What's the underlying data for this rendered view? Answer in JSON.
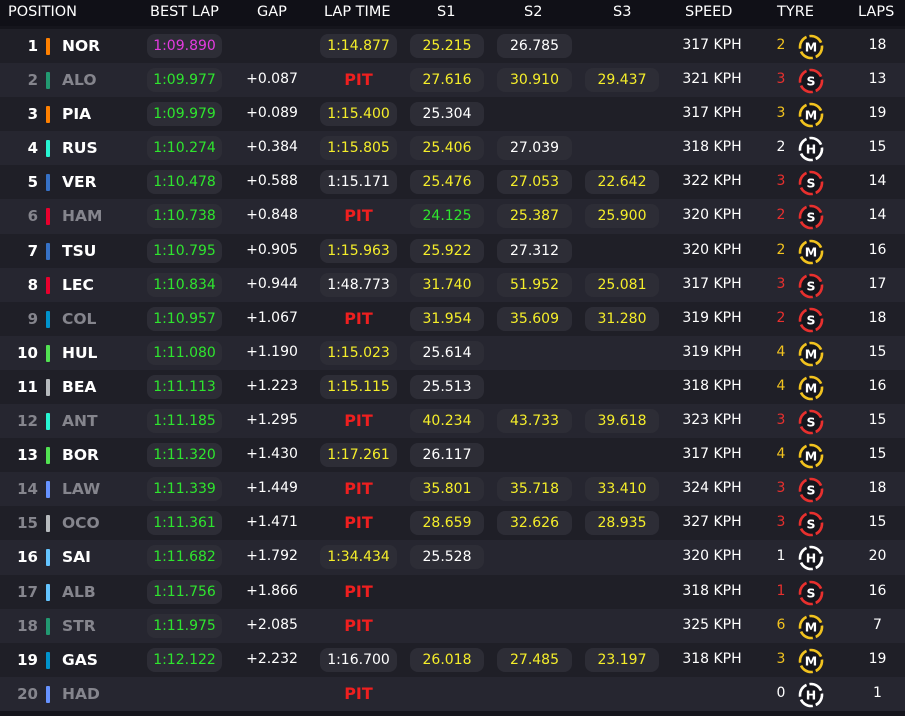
{
  "colors": {
    "purple": "#e43be0",
    "green": "#2ee52e",
    "yellow": "#f5ee2a",
    "white": "#ffffff",
    "pit_red": "#ee1f1f",
    "tyre_soft": "#e8302e",
    "tyre_medium": "#f2c31f",
    "tyre_hard": "#ffffff",
    "age_new": "#ffffff",
    "age_mid": "#f2c31f",
    "age_old": "#e8302e"
  },
  "headers": {
    "position": "POSITION",
    "best_lap": "BEST LAP",
    "gap": "GAP",
    "lap_time": "LAP TIME",
    "s1": "S1",
    "s2": "S2",
    "s3": "S3",
    "speed": "SPEED",
    "tyre": "TYRE",
    "laps": "LAPS"
  },
  "rows": [
    {
      "pos": "1",
      "code": "NOR",
      "team": "#ff8000",
      "out": false,
      "best": "1:09.890",
      "best_c": "purple",
      "gap": "",
      "lap": "1:14.877",
      "lap_c": "yellow",
      "pit": false,
      "s1": "25.215",
      "s1_c": "yellow",
      "s2": "26.785",
      "s2_c": "white",
      "s3": "",
      "s3_c": "white",
      "speed": "317 KPH",
      "tyre_age": "2",
      "age_c": "age_mid",
      "tyre": "M",
      "laps": "18"
    },
    {
      "pos": "2",
      "code": "ALO",
      "team": "#229971",
      "out": true,
      "best": "1:09.977",
      "best_c": "green",
      "gap": "+0.087",
      "lap": "PIT",
      "lap_c": "white",
      "pit": true,
      "s1": "27.616",
      "s1_c": "yellow",
      "s2": "30.910",
      "s2_c": "yellow",
      "s3": "29.437",
      "s3_c": "yellow",
      "speed": "321 KPH",
      "tyre_age": "3",
      "age_c": "age_old",
      "tyre": "S",
      "laps": "13"
    },
    {
      "pos": "3",
      "code": "PIA",
      "team": "#ff8000",
      "out": false,
      "best": "1:09.979",
      "best_c": "green",
      "gap": "+0.089",
      "lap": "1:15.400",
      "lap_c": "yellow",
      "pit": false,
      "s1": "25.304",
      "s1_c": "white",
      "s2": "",
      "s2_c": "white",
      "s3": "",
      "s3_c": "white",
      "speed": "317 KPH",
      "tyre_age": "3",
      "age_c": "age_mid",
      "tyre": "M",
      "laps": "19"
    },
    {
      "pos": "4",
      "code": "RUS",
      "team": "#27f4d2",
      "out": false,
      "best": "1:10.274",
      "best_c": "green",
      "gap": "+0.384",
      "lap": "1:15.805",
      "lap_c": "yellow",
      "pit": false,
      "s1": "25.406",
      "s1_c": "yellow",
      "s2": "27.039",
      "s2_c": "white",
      "s3": "",
      "s3_c": "white",
      "speed": "318 KPH",
      "tyre_age": "2",
      "age_c": "age_new",
      "tyre": "H",
      "laps": "15"
    },
    {
      "pos": "5",
      "code": "VER",
      "team": "#3671c6",
      "out": false,
      "best": "1:10.478",
      "best_c": "green",
      "gap": "+0.588",
      "lap": "1:15.171",
      "lap_c": "white",
      "pit": false,
      "s1": "25.476",
      "s1_c": "yellow",
      "s2": "27.053",
      "s2_c": "yellow",
      "s3": "22.642",
      "s3_c": "yellow",
      "speed": "322 KPH",
      "tyre_age": "3",
      "age_c": "age_old",
      "tyre": "S",
      "laps": "14"
    },
    {
      "pos": "6",
      "code": "HAM",
      "team": "#e8002d",
      "out": true,
      "best": "1:10.738",
      "best_c": "green",
      "gap": "+0.848",
      "lap": "PIT",
      "lap_c": "white",
      "pit": true,
      "s1": "24.125",
      "s1_c": "green",
      "s2": "25.387",
      "s2_c": "yellow",
      "s3": "25.900",
      "s3_c": "yellow",
      "speed": "320 KPH",
      "tyre_age": "2",
      "age_c": "age_old",
      "tyre": "S",
      "laps": "14"
    },
    {
      "pos": "7",
      "code": "TSU",
      "team": "#3671c6",
      "out": false,
      "best": "1:10.795",
      "best_c": "green",
      "gap": "+0.905",
      "lap": "1:15.963",
      "lap_c": "yellow",
      "pit": false,
      "s1": "25.922",
      "s1_c": "yellow",
      "s2": "27.312",
      "s2_c": "white",
      "s3": "",
      "s3_c": "white",
      "speed": "320 KPH",
      "tyre_age": "2",
      "age_c": "age_mid",
      "tyre": "M",
      "laps": "16"
    },
    {
      "pos": "8",
      "code": "LEC",
      "team": "#e8002d",
      "out": false,
      "best": "1:10.834",
      "best_c": "green",
      "gap": "+0.944",
      "lap": "1:48.773",
      "lap_c": "white",
      "pit": false,
      "s1": "31.740",
      "s1_c": "yellow",
      "s2": "51.952",
      "s2_c": "yellow",
      "s3": "25.081",
      "s3_c": "yellow",
      "speed": "317 KPH",
      "tyre_age": "3",
      "age_c": "age_old",
      "tyre": "S",
      "laps": "17"
    },
    {
      "pos": "9",
      "code": "COL",
      "team": "#0093cc",
      "out": true,
      "best": "1:10.957",
      "best_c": "green",
      "gap": "+1.067",
      "lap": "PIT",
      "lap_c": "white",
      "pit": true,
      "s1": "31.954",
      "s1_c": "yellow",
      "s2": "35.609",
      "s2_c": "yellow",
      "s3": "31.280",
      "s3_c": "yellow",
      "speed": "319 KPH",
      "tyre_age": "2",
      "age_c": "age_old",
      "tyre": "S",
      "laps": "18"
    },
    {
      "pos": "10",
      "code": "HUL",
      "team": "#52e252",
      "out": false,
      "best": "1:11.080",
      "best_c": "green",
      "gap": "+1.190",
      "lap": "1:15.023",
      "lap_c": "yellow",
      "pit": false,
      "s1": "25.614",
      "s1_c": "white",
      "s2": "",
      "s2_c": "white",
      "s3": "",
      "s3_c": "white",
      "speed": "319 KPH",
      "tyre_age": "4",
      "age_c": "age_mid",
      "tyre": "M",
      "laps": "15"
    },
    {
      "pos": "11",
      "code": "BEA",
      "team": "#b6babd",
      "out": false,
      "best": "1:11.113",
      "best_c": "green",
      "gap": "+1.223",
      "lap": "1:15.115",
      "lap_c": "yellow",
      "pit": false,
      "s1": "25.513",
      "s1_c": "white",
      "s2": "",
      "s2_c": "white",
      "s3": "",
      "s3_c": "white",
      "speed": "318 KPH",
      "tyre_age": "4",
      "age_c": "age_mid",
      "tyre": "M",
      "laps": "16"
    },
    {
      "pos": "12",
      "code": "ANT",
      "team": "#27f4d2",
      "out": true,
      "best": "1:11.185",
      "best_c": "green",
      "gap": "+1.295",
      "lap": "PIT",
      "lap_c": "white",
      "pit": true,
      "s1": "40.234",
      "s1_c": "yellow",
      "s2": "43.733",
      "s2_c": "yellow",
      "s3": "39.618",
      "s3_c": "yellow",
      "speed": "323 KPH",
      "tyre_age": "3",
      "age_c": "age_old",
      "tyre": "S",
      "laps": "15"
    },
    {
      "pos": "13",
      "code": "BOR",
      "team": "#52e252",
      "out": false,
      "best": "1:11.320",
      "best_c": "green",
      "gap": "+1.430",
      "lap": "1:17.261",
      "lap_c": "yellow",
      "pit": false,
      "s1": "26.117",
      "s1_c": "white",
      "s2": "",
      "s2_c": "white",
      "s3": "",
      "s3_c": "white",
      "speed": "317 KPH",
      "tyre_age": "4",
      "age_c": "age_mid",
      "tyre": "M",
      "laps": "15"
    },
    {
      "pos": "14",
      "code": "LAW",
      "team": "#6692ff",
      "out": true,
      "best": "1:11.339",
      "best_c": "green",
      "gap": "+1.449",
      "lap": "PIT",
      "lap_c": "white",
      "pit": true,
      "s1": "35.801",
      "s1_c": "yellow",
      "s2": "35.718",
      "s2_c": "yellow",
      "s3": "33.410",
      "s3_c": "yellow",
      "speed": "324 KPH",
      "tyre_age": "3",
      "age_c": "age_old",
      "tyre": "S",
      "laps": "18"
    },
    {
      "pos": "15",
      "code": "OCO",
      "team": "#b6babd",
      "out": true,
      "best": "1:11.361",
      "best_c": "green",
      "gap": "+1.471",
      "lap": "PIT",
      "lap_c": "white",
      "pit": true,
      "s1": "28.659",
      "s1_c": "yellow",
      "s2": "32.626",
      "s2_c": "yellow",
      "s3": "28.935",
      "s3_c": "yellow",
      "speed": "327 KPH",
      "tyre_age": "3",
      "age_c": "age_old",
      "tyre": "S",
      "laps": "15"
    },
    {
      "pos": "16",
      "code": "SAI",
      "team": "#64c4ff",
      "out": false,
      "best": "1:11.682",
      "best_c": "green",
      "gap": "+1.792",
      "lap": "1:34.434",
      "lap_c": "yellow",
      "pit": false,
      "s1": "25.528",
      "s1_c": "white",
      "s2": "",
      "s2_c": "white",
      "s3": "",
      "s3_c": "white",
      "speed": "320 KPH",
      "tyre_age": "1",
      "age_c": "age_new",
      "tyre": "H",
      "laps": "20"
    },
    {
      "pos": "17",
      "code": "ALB",
      "team": "#64c4ff",
      "out": true,
      "best": "1:11.756",
      "best_c": "green",
      "gap": "+1.866",
      "lap": "PIT",
      "lap_c": "white",
      "pit": true,
      "s1": "",
      "s1_c": "white",
      "s2": "",
      "s2_c": "white",
      "s3": "",
      "s3_c": "white",
      "speed": "318 KPH",
      "tyre_age": "1",
      "age_c": "age_old",
      "tyre": "S",
      "laps": "16"
    },
    {
      "pos": "18",
      "code": "STR",
      "team": "#229971",
      "out": true,
      "best": "1:11.975",
      "best_c": "green",
      "gap": "+2.085",
      "lap": "PIT",
      "lap_c": "white",
      "pit": true,
      "s1": "",
      "s1_c": "white",
      "s2": "",
      "s2_c": "white",
      "s3": "",
      "s3_c": "white",
      "speed": "325 KPH",
      "tyre_age": "6",
      "age_c": "age_mid",
      "tyre": "M",
      "laps": "7"
    },
    {
      "pos": "19",
      "code": "GAS",
      "team": "#0093cc",
      "out": false,
      "best": "1:12.122",
      "best_c": "green",
      "gap": "+2.232",
      "lap": "1:16.700",
      "lap_c": "white",
      "pit": false,
      "s1": "26.018",
      "s1_c": "yellow",
      "s2": "27.485",
      "s2_c": "yellow",
      "s3": "23.197",
      "s3_c": "yellow",
      "speed": "318 KPH",
      "tyre_age": "3",
      "age_c": "age_mid",
      "tyre": "M",
      "laps": "19"
    },
    {
      "pos": "20",
      "code": "HAD",
      "team": "#6692ff",
      "out": true,
      "best": "",
      "best_c": "green",
      "gap": "",
      "lap": "PIT",
      "lap_c": "white",
      "pit": true,
      "s1": "",
      "s1_c": "white",
      "s2": "",
      "s2_c": "white",
      "s3": "",
      "s3_c": "white",
      "speed": "",
      "tyre_age": "0",
      "age_c": "age_new",
      "tyre": "H",
      "laps": "1"
    }
  ]
}
